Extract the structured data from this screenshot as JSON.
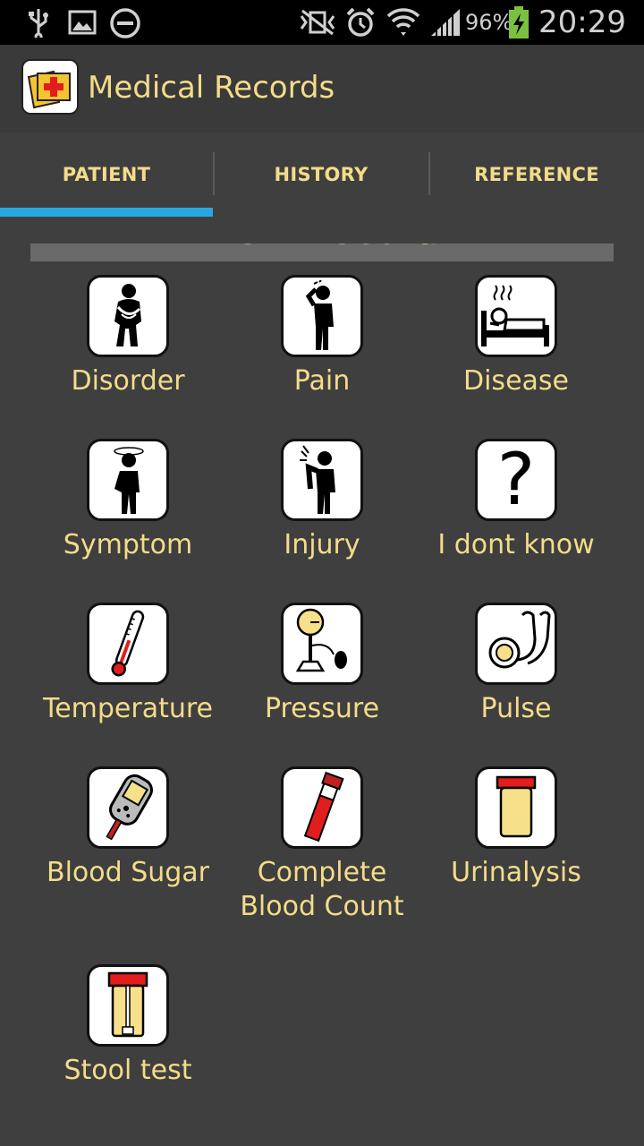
{
  "status_bar": {
    "battery_pct": "96%",
    "time": "20:29",
    "icons": [
      "usb-icon",
      "image-icon",
      "do-not-disturb-icon",
      "vibrate-icon",
      "alarm-icon",
      "wifi-icon",
      "signal-icon",
      "battery-charging-icon"
    ]
  },
  "app": {
    "title": "Medical Records",
    "icon": "medical-kit-icon"
  },
  "tabs": [
    {
      "label": "PATIENT",
      "selected": true
    },
    {
      "label": "HISTORY",
      "selected": false
    },
    {
      "label": "REFERENCE",
      "selected": false
    }
  ],
  "section": {
    "title": "New Record"
  },
  "records": [
    {
      "label": "Disorder",
      "icon": "stomach-ache-icon"
    },
    {
      "label": "Pain",
      "icon": "headache-icon"
    },
    {
      "label": "Disease",
      "icon": "sick-in-bed-icon"
    },
    {
      "label": "Symptom",
      "icon": "dizzy-person-icon"
    },
    {
      "label": "Injury",
      "icon": "injured-person-icon"
    },
    {
      "label": "I dont know",
      "icon": "question-mark-icon"
    },
    {
      "label": "Temperature",
      "icon": "thermometer-icon"
    },
    {
      "label": "Pressure",
      "icon": "blood-pressure-gauge-icon"
    },
    {
      "label": "Pulse",
      "icon": "stethoscope-icon"
    },
    {
      "label": "Blood Sugar",
      "icon": "glucometer-icon"
    },
    {
      "label": "Complete\nBlood Count",
      "line1": "Complete",
      "line2": "Blood Count",
      "icon": "blood-tube-icon"
    },
    {
      "label": "Urinalysis",
      "icon": "urine-cup-icon"
    },
    {
      "label": "Stool test",
      "icon": "stool-container-icon"
    }
  ],
  "colors": {
    "accent": "#29a8e0",
    "label": "#f3dc8a",
    "background": "#3f3f3f"
  }
}
